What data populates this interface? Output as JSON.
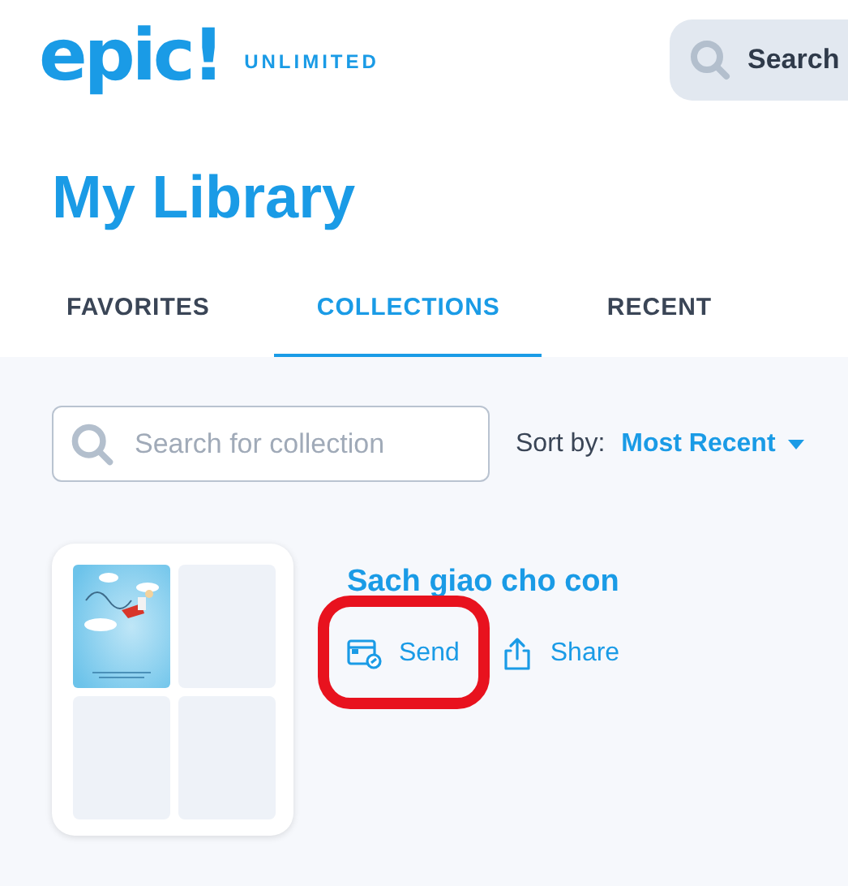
{
  "header": {
    "logo": "epic!",
    "plan": "UNLIMITED",
    "search": {
      "placeholder": "Search"
    }
  },
  "page_title": "My Library",
  "tabs": [
    {
      "label": "FAVORITES",
      "selected": false
    },
    {
      "label": "COLLECTIONS",
      "selected": true
    },
    {
      "label": "RECENT",
      "selected": false
    }
  ],
  "collection_search": {
    "placeholder": "Search for collection"
  },
  "sort": {
    "label": "Sort by:",
    "value": "Most Recent"
  },
  "collections": [
    {
      "title": "Sach giao cho con",
      "covers": [
        {
          "kind": "picture"
        },
        {
          "kind": "empty"
        },
        {
          "kind": "empty"
        },
        {
          "kind": "empty"
        }
      ],
      "actions": [
        {
          "kind": "send",
          "label": "Send",
          "highlighted": true
        },
        {
          "kind": "share",
          "label": "Share",
          "highlighted": false
        }
      ]
    }
  ]
}
